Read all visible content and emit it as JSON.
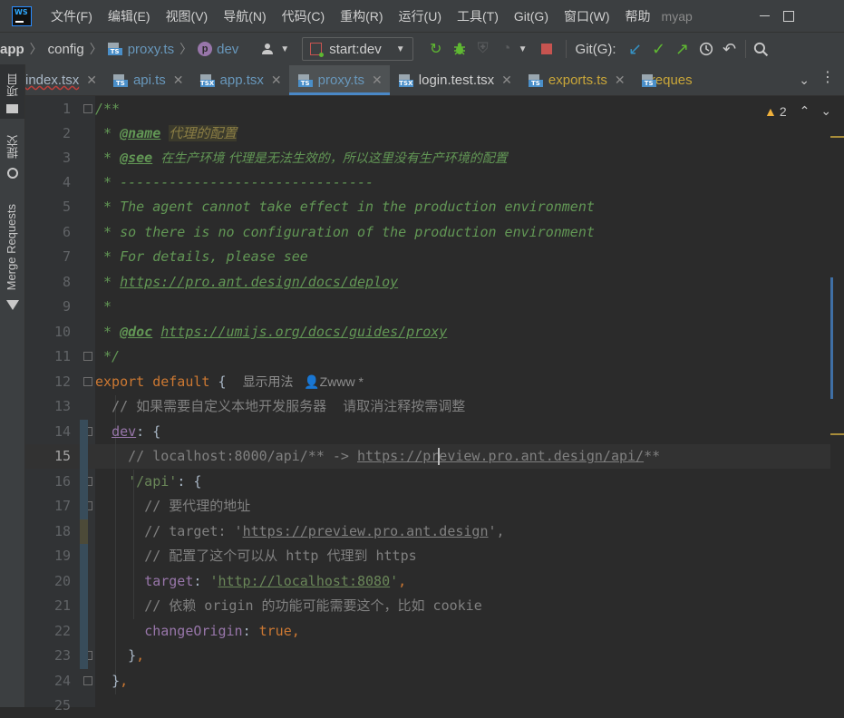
{
  "menubar": {
    "items": [
      "文件(F)",
      "编辑(E)",
      "视图(V)",
      "导航(N)",
      "代码(C)",
      "重构(R)",
      "运行(U)",
      "工具(T)",
      "Git(G)",
      "窗口(W)",
      "帮助"
    ],
    "project": "myap"
  },
  "navbar": {
    "breadcrumbs": [
      "app",
      "config",
      "proxy.ts",
      "dev"
    ],
    "run_config": "start:dev",
    "git_label": "Git(G):"
  },
  "tabs": [
    {
      "label": "index.tsx",
      "kind": "TSX",
      "color": "#a9b7c6"
    },
    {
      "label": "api.ts",
      "kind": "TS",
      "color": "#6897bb"
    },
    {
      "label": "app.tsx",
      "kind": "TSX",
      "color": "#6897bb"
    },
    {
      "label": "proxy.ts",
      "kind": "TS",
      "color": "#6897bb"
    },
    {
      "label": "login.test.tsx",
      "kind": "TSX",
      "color": "#d0d0d0"
    },
    {
      "label": "exports.ts",
      "kind": "TS",
      "color": "#c9a639"
    },
    {
      "label": "reques",
      "kind": "TS",
      "color": "#c9a639"
    }
  ],
  "sidebar": {
    "project_label": "项目",
    "commit_label": "提交",
    "merge_label": "Merge Requests"
  },
  "editor": {
    "warning_count": "2",
    "current_line": 15,
    "line_numbers": [
      "1",
      "2",
      "3",
      "4",
      "5",
      "6",
      "7",
      "8",
      "9",
      "10",
      "11",
      "12",
      "13",
      "14",
      "15",
      "16",
      "17",
      "18",
      "19",
      "20",
      "21",
      "22",
      "23",
      "24",
      "25"
    ],
    "code": {
      "l1": "/**",
      "l2_tag": "@name",
      "l2_val": "代理的配置",
      "l3_tag": "@see",
      "l3_text": "在生产环境 代理是无法生效的，所以这里没有生产环境的配置",
      "l4": "-------------------------------",
      "l5": "The agent cannot take effect in the production environment",
      "l6": "so there is no configuration of the production environment",
      "l7": "For details, please see",
      "l8_url": "https://pro.ant.design/docs/deploy",
      "l10_tag": "@doc",
      "l10_url": "https://umijs.org/docs/guides/proxy",
      "l11": "*/",
      "l12_kw": "export default",
      "l12_hint": "显示用法",
      "l12_author": "Zwww *",
      "l13": "// 如果需要自定义本地开发服务器  请取消注释按需调整",
      "l14_key": "dev",
      "l15_pre": "// localhost:8000/api/** -> ",
      "l15_url": "https://preview.pro.ant.design/api/",
      "l15_post": "**",
      "l16_str": "'/api'",
      "l17": "// 要代理的地址",
      "l18_pre": "// target: '",
      "l18_url": "https://preview.pro.ant.design",
      "l18_post": "',",
      "l19": "// 配置了这个可以从 http 代理到 https",
      "l20_key": "target",
      "l20_url": "http://localhost:8080",
      "l21": "// 依赖 origin 的功能可能需要这个，比如 cookie",
      "l22_key": "changeOrigin",
      "l22_val": "true"
    }
  }
}
